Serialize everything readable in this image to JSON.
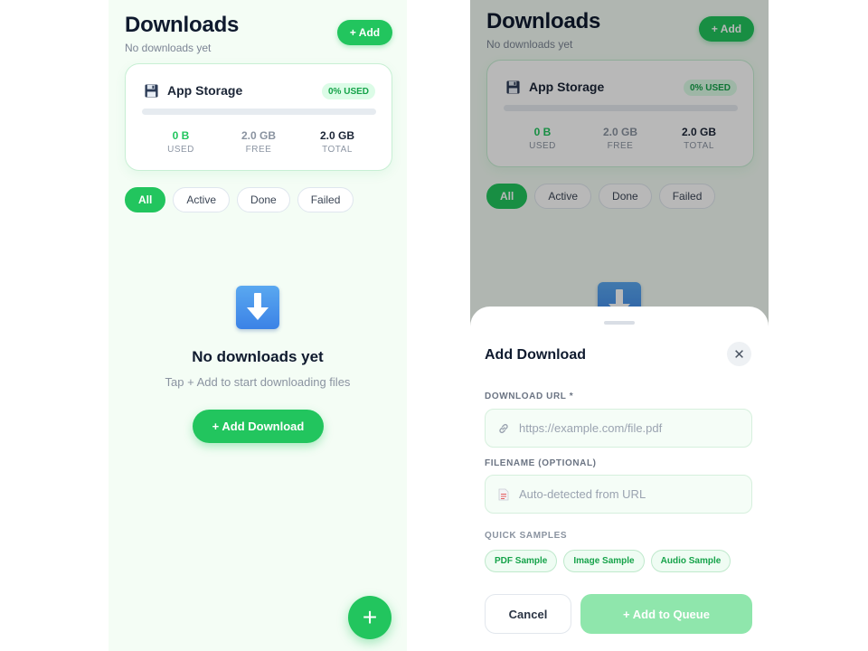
{
  "screens": [
    {
      "header": {
        "title": "Downloads",
        "subtitle": "No downloads yet",
        "add_label": "+ Add"
      },
      "storage": {
        "title": "App Storage",
        "icon": "floppy-disk-icon",
        "percent_label": "0% USED",
        "used_fraction": 0,
        "stats": [
          {
            "value": "0 B",
            "label": "USED"
          },
          {
            "value": "2.0 GB",
            "label": "FREE"
          },
          {
            "value": "2.0 GB",
            "label": "TOTAL"
          }
        ]
      },
      "filters": [
        "All",
        "Active",
        "Done",
        "Failed"
      ],
      "active_filter": "All",
      "empty": {
        "icon": "download-arrow-icon",
        "title": "No downloads yet",
        "subtitle": "Tap + Add to start downloading files",
        "button_label": "+ Add Download"
      },
      "fab_label": "+"
    },
    {
      "header": {
        "title": "Downloads",
        "subtitle": "No downloads yet",
        "add_label": "+ Add"
      },
      "storage": {
        "title": "App Storage",
        "icon": "floppy-disk-icon",
        "percent_label": "0% USED",
        "used_fraction": 0,
        "stats": [
          {
            "value": "0 B",
            "label": "USED"
          },
          {
            "value": "2.0 GB",
            "label": "FREE"
          },
          {
            "value": "2.0 GB",
            "label": "TOTAL"
          }
        ]
      },
      "filters": [
        "All",
        "Active",
        "Done",
        "Failed"
      ],
      "active_filter": "All"
    }
  ],
  "sheet": {
    "title": "Add Download",
    "close_label": "✕",
    "url_label": "DOWNLOAD URL *",
    "url_placeholder": "https://example.com/file.pdf",
    "url_icon": "link-icon",
    "filename_label": "FILENAME (OPTIONAL)",
    "filename_placeholder": "Auto-detected from URL",
    "filename_icon": "document-icon",
    "samples_label": "QUICK SAMPLES",
    "samples": [
      "PDF Sample",
      "Image Sample",
      "Audio Sample"
    ],
    "cancel_label": "Cancel",
    "submit_label": "+ Add to Queue"
  },
  "colors": {
    "accent": "#22c55e",
    "background": "#f4fdf5",
    "title": "#0f1a2e",
    "disabled_accent": "#8fe6ac"
  }
}
